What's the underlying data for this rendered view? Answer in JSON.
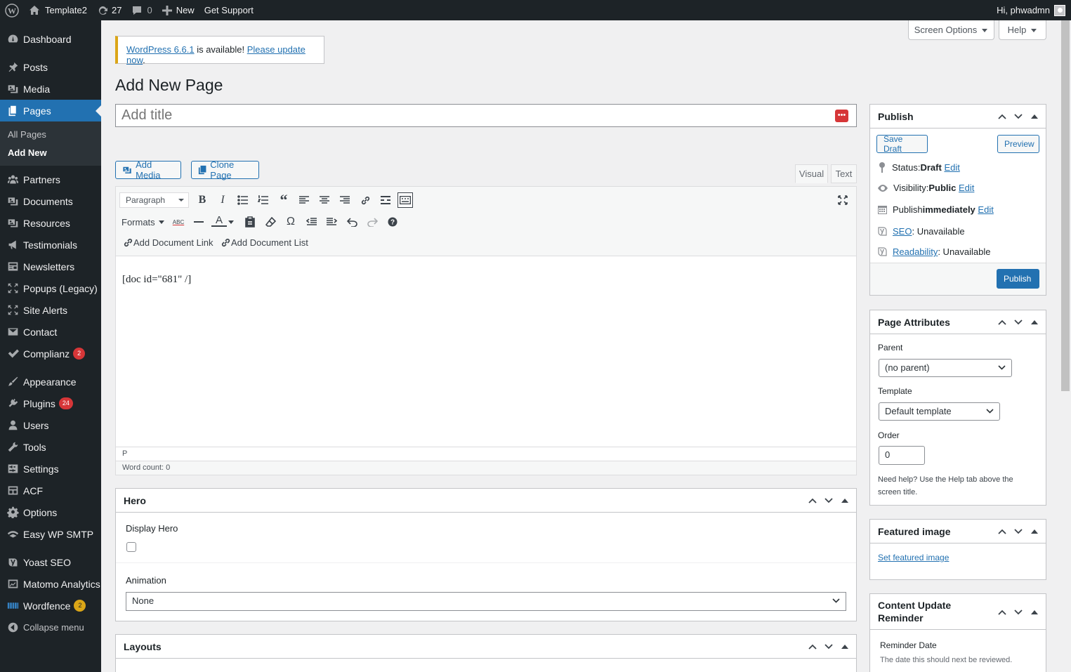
{
  "adminbar": {
    "site_name": "Template2",
    "updates_count": "27",
    "comments_count": "0",
    "new_label": "New",
    "support_label": "Get Support",
    "greeting": "Hi, phwadmn"
  },
  "sidebar": {
    "items": [
      {
        "label": "Dashboard"
      },
      {
        "label": "Posts"
      },
      {
        "label": "Media"
      },
      {
        "label": "Pages"
      },
      {
        "label": "Partners"
      },
      {
        "label": "Documents"
      },
      {
        "label": "Resources"
      },
      {
        "label": "Testimonials"
      },
      {
        "label": "Newsletters"
      },
      {
        "label": "Popups (Legacy)"
      },
      {
        "label": "Site Alerts"
      },
      {
        "label": "Contact"
      },
      {
        "label": "Complianz",
        "badge": "2"
      },
      {
        "label": "Appearance"
      },
      {
        "label": "Plugins",
        "badge": "24"
      },
      {
        "label": "Users"
      },
      {
        "label": "Tools"
      },
      {
        "label": "Settings"
      },
      {
        "label": "ACF"
      },
      {
        "label": "Options"
      },
      {
        "label": "Easy WP SMTP"
      },
      {
        "label": "Yoast SEO"
      },
      {
        "label": "Matomo Analytics"
      },
      {
        "label": "Wordfence",
        "badge": "2"
      },
      {
        "label": "Collapse menu"
      }
    ],
    "submenu": [
      "All Pages",
      "Add New"
    ]
  },
  "screen_options": "Screen Options",
  "help": "Help",
  "notice": {
    "version_link": "WordPress 6.6.1",
    "text": " is available! ",
    "update_link": "Please update now",
    "end": "."
  },
  "page_title": "Add New Page",
  "title_placeholder": "Add title",
  "buttons": {
    "add_media": "Add Media",
    "clone_page": "Clone Page"
  },
  "editor": {
    "tab_visual": "Visual",
    "tab_text": "Text",
    "format_value": "Paragraph",
    "formats_label": "Formats",
    "add_doc_link": "Add Document Link",
    "add_doc_list": "Add Document List",
    "content": "[doc id=\"681\" /]",
    "path": "P",
    "word_count": "Word count: 0"
  },
  "publish": {
    "title": "Publish",
    "save_draft": "Save Draft",
    "preview": "Preview",
    "status_label": "Status: ",
    "status_value": "Draft",
    "visibility_label": "Visibility: ",
    "visibility_value": "Public",
    "publish_label": "Publish ",
    "publish_value": "immediately",
    "edit": "Edit",
    "seo_link": "SEO",
    "seo_value": ": Unavailable",
    "readability_link": "Readability",
    "readability_value": ": Unavailable",
    "publish_button": "Publish"
  },
  "page_attributes": {
    "title": "Page Attributes",
    "parent_label": "Parent",
    "parent_value": "(no parent)",
    "template_label": "Template",
    "template_value": "Default template",
    "order_label": "Order",
    "order_value": "0",
    "help_text": "Need help? Use the Help tab above the screen title."
  },
  "featured_image": {
    "title": "Featured image",
    "link": "Set featured image"
  },
  "reminder": {
    "title": "Content Update Reminder",
    "date_label": "Reminder Date",
    "desc": "The date this should next be reviewed."
  },
  "hero": {
    "title": "Hero",
    "display_label": "Display Hero",
    "animation_label": "Animation",
    "animation_value": "None"
  },
  "layouts": {
    "title": "Layouts"
  },
  "colors": {
    "admin_dark": "#1d2327",
    "accent": "#2271b1",
    "badge_red": "#d63638",
    "badge_yellow": "#dba617"
  }
}
